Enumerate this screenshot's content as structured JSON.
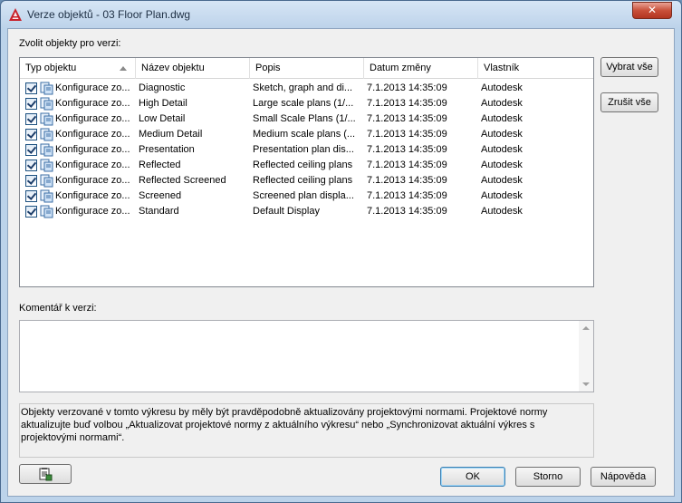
{
  "window": {
    "title": "Verze objektů - 03 Floor Plan.dwg",
    "close_glyph": "✕"
  },
  "labels": {
    "select_objects": "Zvolit objekty pro verzi:",
    "comment": "Komentář k verzi:"
  },
  "table": {
    "columns": [
      "Typ objektu",
      "Název objektu",
      "Popis",
      "Datum změny",
      "Vlastník"
    ],
    "rows": [
      {
        "type": "Konfigurace zo...",
        "name": "Diagnostic",
        "desc": "Sketch, graph and di...",
        "date": "7.1.2013 14:35:09",
        "owner": "Autodesk"
      },
      {
        "type": "Konfigurace zo...",
        "name": "High Detail",
        "desc": "Large scale plans (1/...",
        "date": "7.1.2013 14:35:09",
        "owner": "Autodesk"
      },
      {
        "type": "Konfigurace zo...",
        "name": "Low Detail",
        "desc": "Small Scale Plans (1/...",
        "date": "7.1.2013 14:35:09",
        "owner": "Autodesk"
      },
      {
        "type": "Konfigurace zo...",
        "name": "Medium Detail",
        "desc": "Medium scale plans (...",
        "date": "7.1.2013 14:35:09",
        "owner": "Autodesk"
      },
      {
        "type": "Konfigurace zo...",
        "name": "Presentation",
        "desc": "Presentation plan dis...",
        "date": "7.1.2013 14:35:09",
        "owner": "Autodesk"
      },
      {
        "type": "Konfigurace zo...",
        "name": "Reflected",
        "desc": "Reflected ceiling plans",
        "date": "7.1.2013 14:35:09",
        "owner": "Autodesk"
      },
      {
        "type": "Konfigurace zo...",
        "name": "Reflected Screened",
        "desc": "Reflected ceiling plans",
        "date": "7.1.2013 14:35:09",
        "owner": "Autodesk"
      },
      {
        "type": "Konfigurace zo...",
        "name": "Screened",
        "desc": "Screened plan displa...",
        "date": "7.1.2013 14:35:09",
        "owner": "Autodesk"
      },
      {
        "type": "Konfigurace zo...",
        "name": "Standard",
        "desc": "Default Display",
        "date": "7.1.2013 14:35:09",
        "owner": "Autodesk"
      }
    ]
  },
  "buttons": {
    "select_all": "Vybrat vše",
    "deselect_all": "Zrušit vše",
    "ok": "OK",
    "cancel": "Storno",
    "help": "Nápověda"
  },
  "comment_value": "",
  "note": "Objekty verzované v tomto výkresu by měly být pravděpodobně aktualizovány projektovými normami. Projektové normy aktualizujte buď volbou „Aktualizovat projektové normy z aktuálního výkresu“ nebo „Synchronizovat aktuální výkres s projektovými normami“."
}
